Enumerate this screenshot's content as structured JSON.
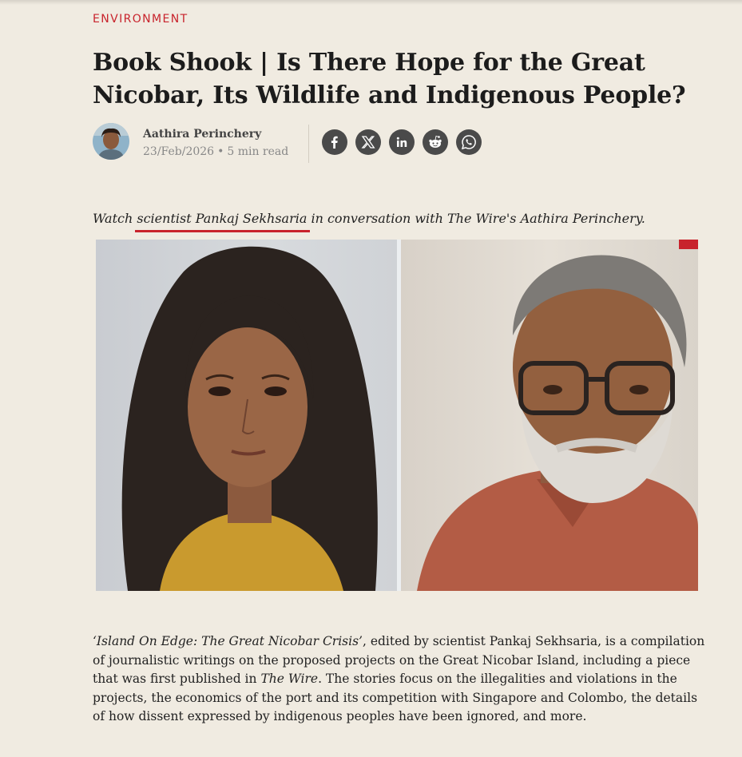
{
  "article": {
    "category": "ENVIRONMENT",
    "headline": "Book Shook | Is There Hope for the Great Nicobar, Its Wildlife and Indigenous People?",
    "author": "Aathira Perinchery",
    "date": "23/Feb/2026",
    "separator": "•",
    "read_time": "5 min read",
    "standfirst": {
      "before": "Watch ",
      "link_text": "scientist Pankaj Sekhsaria",
      "after": " in conversation with The Wire's Aathira Perinchery."
    },
    "body": {
      "italic_title": "‘Island On Edge: The Great Nicobar Crisis’",
      "part1": ", edited by scientist Pankaj Sekhsaria, is a compilation of journalistic writings on the proposed projects on the Great Nicobar Island, including a piece that was first published in ",
      "italic_pub": "The Wire",
      "part2": ". The stories focus on the illegalities and violations in the projects, the economics of the port and its competition with Singapore and Colombo, the details of how dissent expressed by indigenous peoples have been ignored, and more."
    }
  },
  "share": [
    {
      "name": "facebook-icon"
    },
    {
      "name": "x-icon"
    },
    {
      "name": "linkedin-icon"
    },
    {
      "name": "reddit-icon"
    },
    {
      "name": "whatsapp-icon"
    }
  ],
  "colors": {
    "accent": "#c8232c",
    "background": "#f0ebe1",
    "share_button": "#4a4a4a"
  }
}
